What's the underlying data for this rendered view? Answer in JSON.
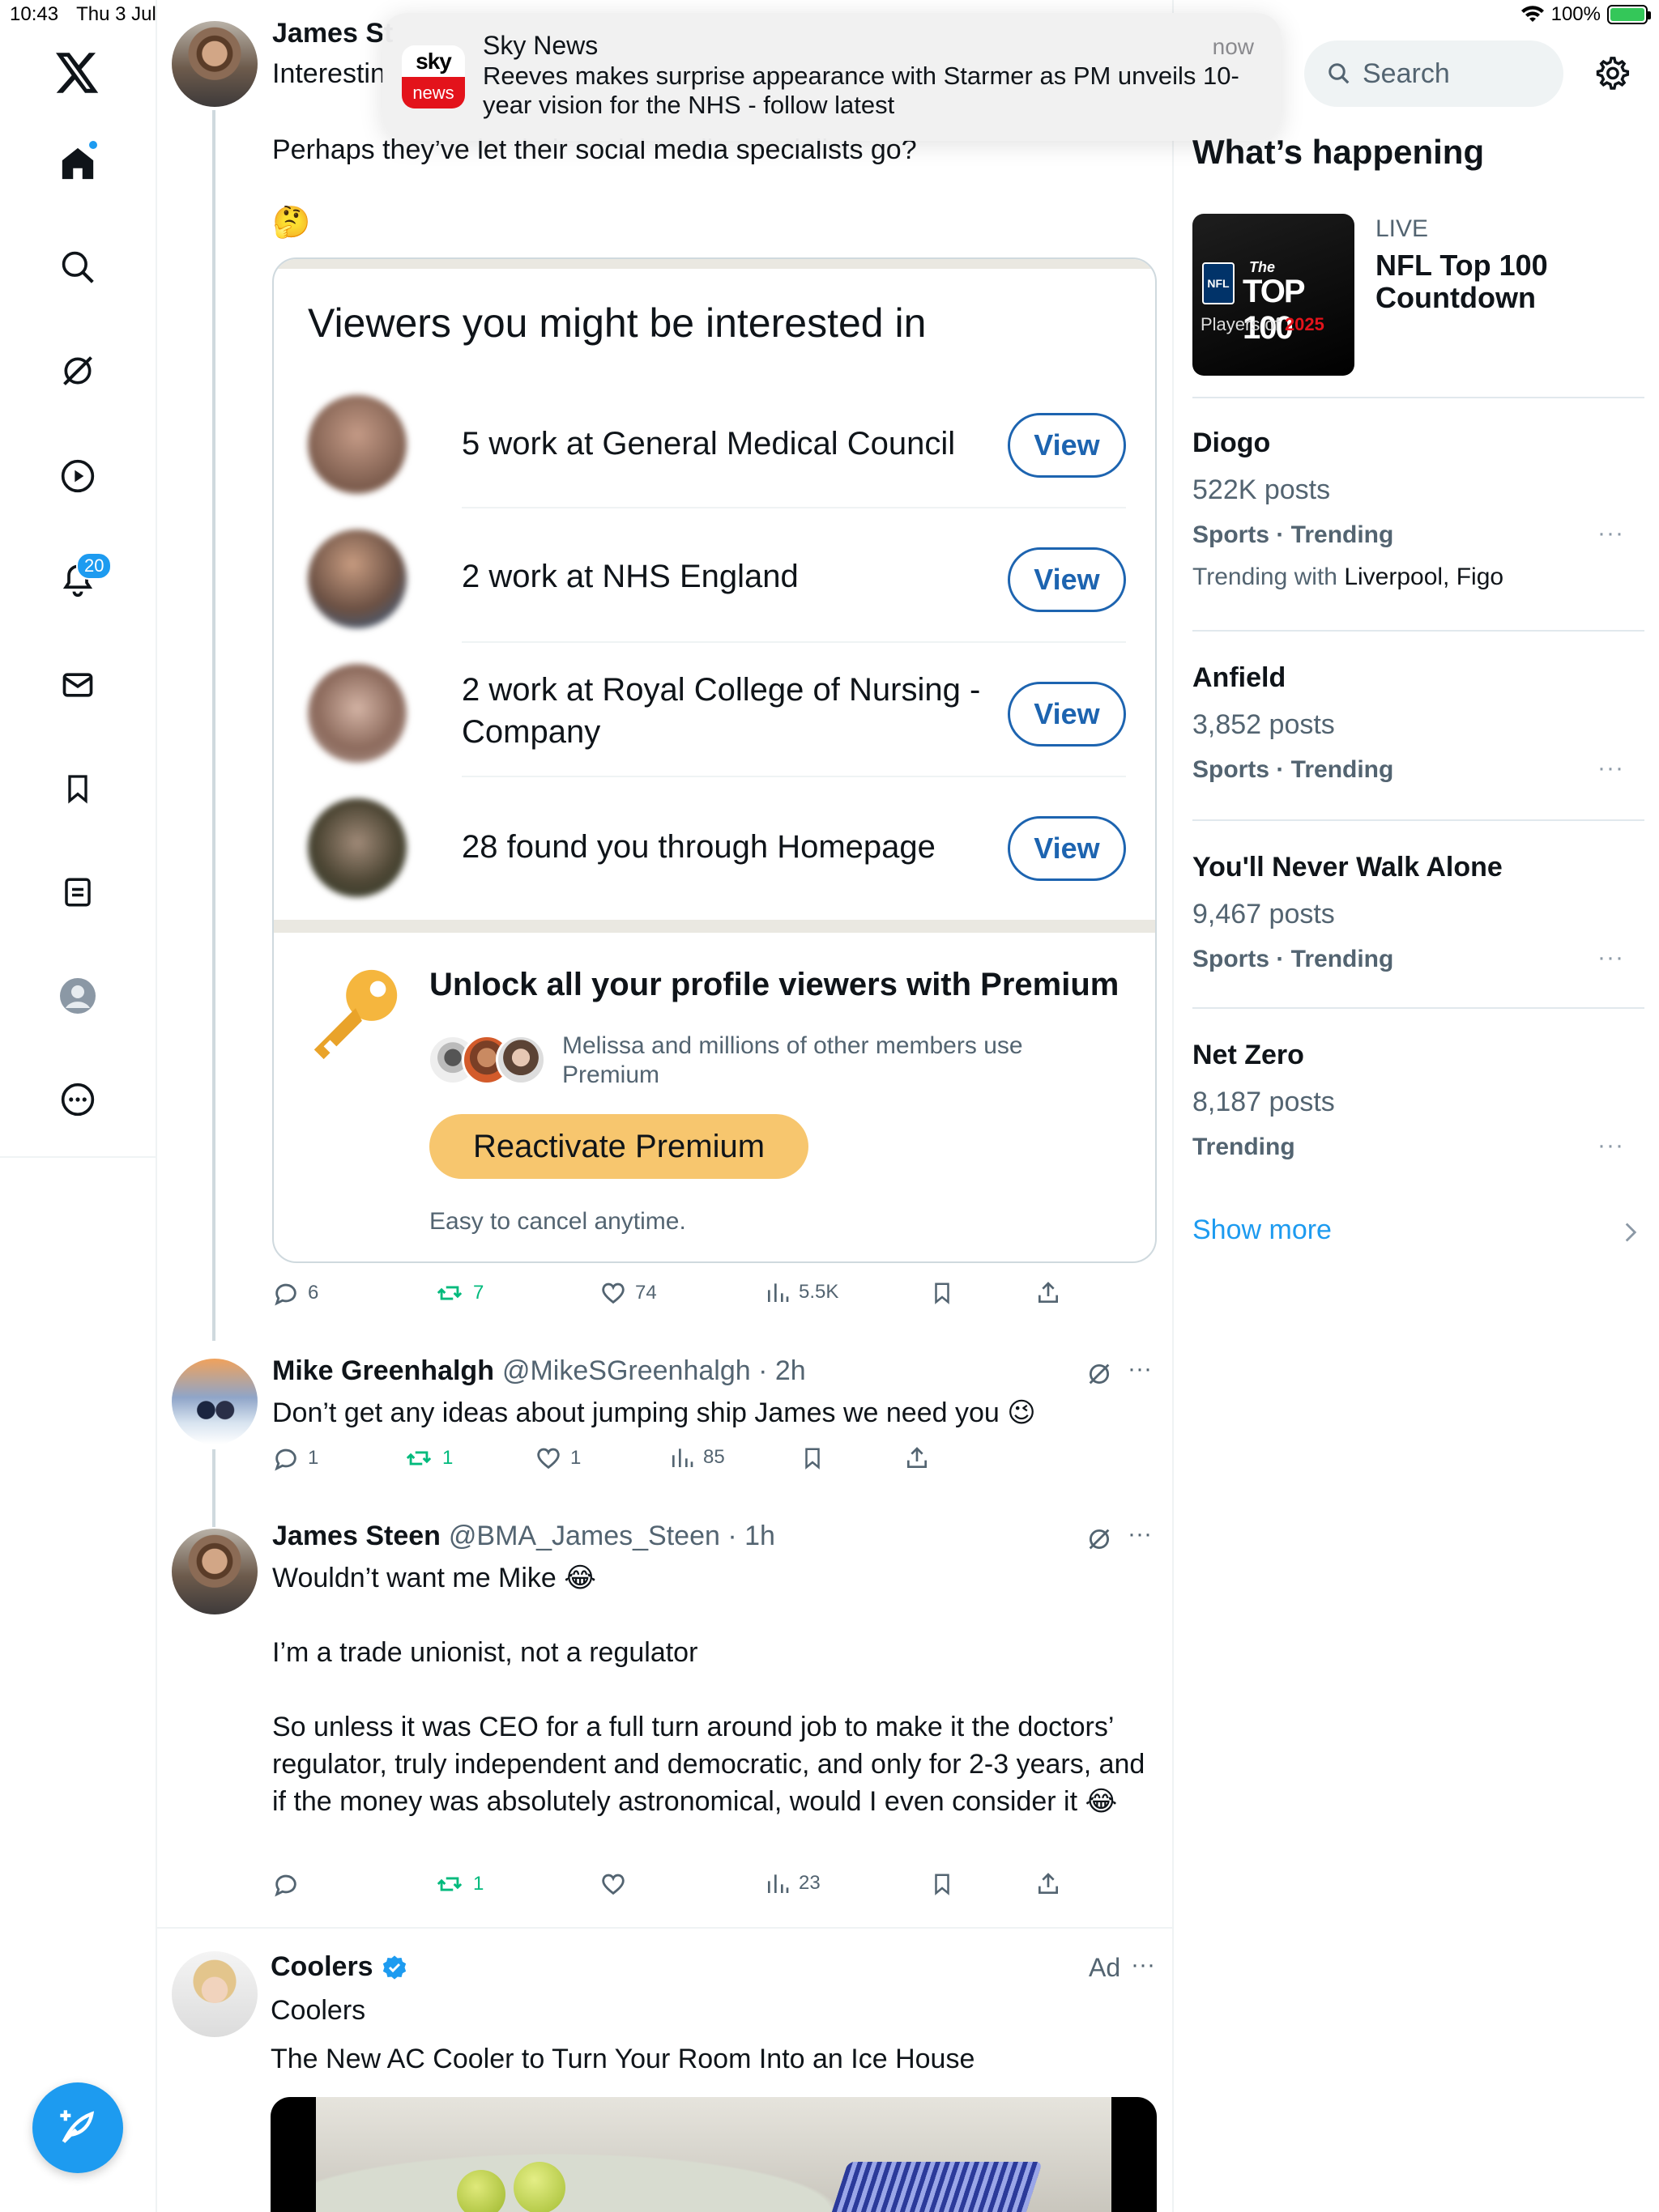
{
  "status_bar": {
    "time": "10:43",
    "date": "Thu 3 Jul",
    "battery": "100%"
  },
  "nav": {
    "notifications_badge": "20"
  },
  "notification": {
    "app": "Sky News",
    "time": "now",
    "message": "Reeves makes surprise appearance with Starmer as PM unveils 10-year vision for the NHS - follow latest",
    "logo_top": "sky",
    "logo_bottom": "news"
  },
  "main_post": {
    "author_name_partial": "James St",
    "text_partial": "Interestin",
    "line2": "Perhaps they’ve let their social media specialists go?",
    "emoji": "🤔",
    "card": {
      "title": "Viewers you might be interested in",
      "rows": [
        {
          "text": "5 work at General Medical Council",
          "button": "View"
        },
        {
          "text": "2 work at NHS England",
          "button": "View"
        },
        {
          "text": "2 work at Royal College of Nursing - Company",
          "button": "View"
        },
        {
          "text": "28 found you through Homepage",
          "button": "View"
        }
      ],
      "premium_title": "Unlock all your profile viewers with Premium",
      "premium_sub": "Melissa and millions of other members use Premium",
      "reactivate": "Reactivate Premium",
      "cancel_note": "Easy to cancel anytime."
    },
    "stats": {
      "replies": "6",
      "reposts": "7",
      "likes": "74",
      "views": "5.5K"
    }
  },
  "reply1": {
    "name": "Mike Greenhalgh",
    "handle": "@MikeSGreenhalgh · 2h",
    "text": "Don’t get any ideas about jumping ship James we need you 😉",
    "stats": {
      "replies": "1",
      "reposts": "1",
      "likes": "1",
      "views": "85"
    }
  },
  "reply2": {
    "name": "James Steen",
    "handle": "@BMA_James_Steen · 1h",
    "p1": "Wouldn’t want me Mike 😂",
    "p2": "I’m a trade unionist, not a regulator",
    "p3": "So unless it was CEO for a full turn around job to make it the doctors’ regulator, truly independent and democratic, and only for 2-3 years, and if the money was absolutely astronomical, would I even consider it 😂",
    "stats": {
      "reposts": "1",
      "views": "23"
    }
  },
  "ad": {
    "name": "Coolers",
    "label": "Ad",
    "subname": "Coolers",
    "text": "The New AC Cooler to Turn Your Room Into an Ice House"
  },
  "sidebar": {
    "search_placeholder": "Search",
    "heading": "What’s happening",
    "live": {
      "label": "LIVE",
      "title": "NFL Top 100 Countdown",
      "img_line1": "The",
      "img_line2": "TOP 100",
      "img_line3a": "Players of ",
      "img_line3b": "2025",
      "img_badge": "NFL"
    },
    "trends": [
      {
        "title": "Diogo",
        "posts": "522K posts",
        "category": "Sports · Trending",
        "with_label": "Trending with ",
        "with_names": "Liverpool, Figo"
      },
      {
        "title": "Anfield",
        "posts": "3,852 posts",
        "category": "Sports · Trending"
      },
      {
        "title": "You'll Never Walk Alone",
        "posts": "9,467 posts",
        "category": "Sports · Trending"
      },
      {
        "title": "Net Zero",
        "posts": "8,187 posts",
        "category": "Trending"
      }
    ],
    "more_glyph": "···",
    "show_more": "Show more"
  },
  "colors": {
    "accent": "#1d9bf0",
    "repost": "#00ba7c",
    "premium": "#f7c66e",
    "view_button": "#1d64b0"
  }
}
